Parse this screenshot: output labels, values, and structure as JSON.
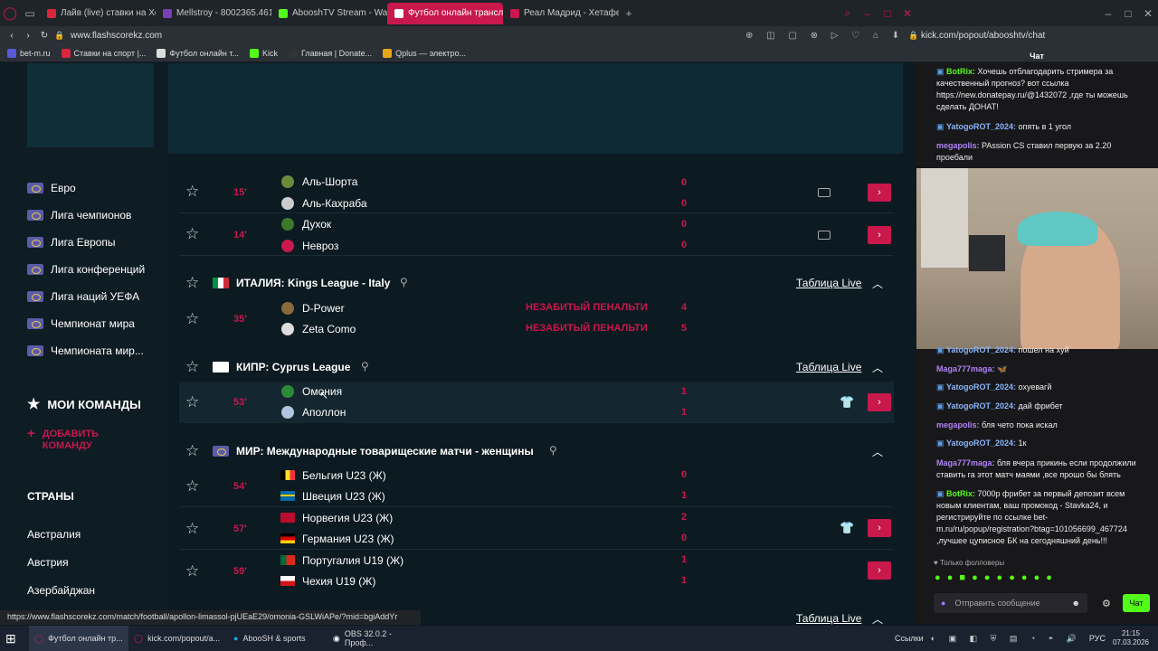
{
  "browser_tabs": [
    {
      "label": "Лайв (live) ставки на Хок",
      "color": "#d7263d",
      "active": false
    },
    {
      "label": "Mellstroy - 8002365.4617",
      "color": "#7b3fb8",
      "active": false
    },
    {
      "label": "AbooshTV Stream - Watc",
      "color": "#53fc18",
      "active": false
    },
    {
      "label": "Футбол онлайн трансля",
      "color": "#ffffff",
      "active": true
    },
    {
      "label": "Реал Мадрид - Хетафе 2",
      "color": "#c8184c",
      "active": false
    }
  ],
  "address_left": "www.flashscorekz.com",
  "address_right": "kick.com/popout/abooshtv/chat",
  "bookmarks": [
    "bet-m.ru",
    "Ставки на спорт |...",
    "Футбол онлайн т...",
    "Kick",
    "Главная | Donate...",
    "Qplus — электро..."
  ],
  "sidebar": {
    "competitions": [
      "Евро",
      "Лига чемпионов",
      "Лига Европы",
      "Лига конференций",
      "Лига наций УЕФА",
      "Чемпионат мира",
      "Чемпионата мир..."
    ],
    "my_teams": "МОИ КОМАНДЫ",
    "add_team": "ДОБАВИТЬ КОМАНДУ",
    "countries_title": "СТРАНЫ",
    "countries": [
      "Австралия",
      "Австрия",
      "Азербайджан"
    ]
  },
  "matches": {
    "m1": {
      "minute": "15'",
      "home": "Аль-Шорта",
      "away": "Аль-Кахраба",
      "hs": "0",
      "as": "0"
    },
    "m2": {
      "minute": "14'",
      "home": "Духок",
      "away": "Невроз",
      "hs": "0",
      "as": "0"
    },
    "l1": {
      "name": "ИТАЛИЯ: Kings League - Italy",
      "table": "Таблица Live"
    },
    "m3": {
      "minute": "35'",
      "home": "D-Power",
      "away": "Zeta Como",
      "hs": "4",
      "as": "5",
      "event": "НЕЗАБИТЫЙ ПЕНАЛЬТИ"
    },
    "l2": {
      "name": "КИПР: Cyprus League",
      "table": "Таблица Live"
    },
    "m4": {
      "minute": "53'",
      "home": "Омония",
      "away": "Аполлон",
      "hs": "1",
      "as": "1"
    },
    "l3": {
      "name": "МИР: Международные товарищеские матчи - женщины"
    },
    "m5": {
      "minute": "54'",
      "home": "Бельгия U23 (Ж)",
      "away": "Швеция U23 (Ж)",
      "hs": "0",
      "as": "1"
    },
    "m6": {
      "minute": "57'",
      "home": "Норвегия U23 (Ж)",
      "away": "Германия U23 (Ж)",
      "hs": "2",
      "as": "0"
    },
    "m7": {
      "minute": "59'",
      "home": "Португалия U19 (Ж)",
      "away": "Чехия U19 (Ж)",
      "hs": "1",
      "as": "1"
    },
    "bottom_table": "Таблица Live"
  },
  "chat": {
    "title": "Чат",
    "top_messages": [
      {
        "user": "BotRix:",
        "text": " Хочешь отблагодарить стримера за качественный прогноз? вот ссылка https://new.donatepay.ru/@1432072 ,где ты можешь сделать ДОНАТ!",
        "color": "#53fc18"
      },
      {
        "user": "YatogoROT_2024:",
        "text": " опять в 1 угол",
        "color": "#8ab4f8"
      },
      {
        "user": "megapolis:",
        "text": " PAssion CS ставил первую за 2.20 проебали",
        "color": "#b084f5"
      }
    ],
    "bottom_messages": [
      {
        "user": "YatogoROT_2024:",
        "text": " пошел на хуй",
        "color": "#8ab4f8"
      },
      {
        "user": "Maga777maga:",
        "text": " 🦋",
        "color": "#b084f5"
      },
      {
        "user": "YatogoROT_2024:",
        "text": " охуевагй",
        "color": "#8ab4f8"
      },
      {
        "user": "YatogoROT_2024:",
        "text": " дай фрибет",
        "color": "#8ab4f8"
      },
      {
        "user": "megapolis:",
        "text": " бля чето пока искал",
        "color": "#b084f5"
      },
      {
        "user": "YatogoROT_2024:",
        "text": " 1к",
        "color": "#8ab4f8"
      },
      {
        "user": "Maga777maga:",
        "text": " бля вчера прикинь если продолжили ставить га этот матч маями ,все прошо бы блять",
        "color": "#b084f5"
      },
      {
        "user": "BotRix:",
        "text": " 7000р фрибет за первый депозит всем новым клиентам, ваш промокод - Stavka24, и регистрируйте по ссылке bet-m.ru/ru/popup/registration?btag=101056699_467724 ,лучшее цуписное БК на сегодняшний день!!!",
        "color": "#53fc18"
      }
    ],
    "followers_only": "Только фолловеры",
    "input_placeholder": "Отправить сообщение",
    "send": "Чат"
  },
  "status_url": "https://www.flashscorekz.com/match/football/apollon-limassol-pjUEaE29/omonia-GSLWiAPe/?mid=bgiAddYr",
  "taskbar": {
    "items": [
      "Футбол онлайн тр...",
      "kick.com/popout/a...",
      "AbooSH & sports",
      "OBS 32.0.2 - Проф..."
    ],
    "links": "Ссылки",
    "lang": "РУС",
    "time": "21:15",
    "date": "07.03.2026"
  }
}
